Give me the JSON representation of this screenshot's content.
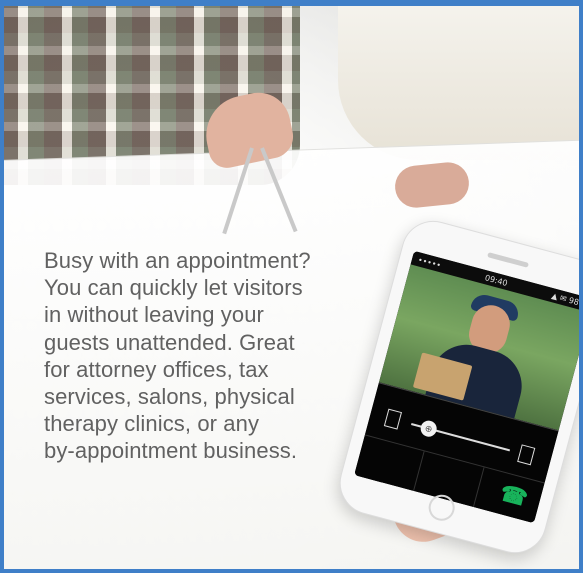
{
  "promo": {
    "lines": [
      "Busy with an appointment?",
      "You can quickly let visitors",
      "in without leaving your",
      "guests unattended. Great",
      "for attorney offices, tax",
      "services, salons, physical",
      "therapy clinics, or any",
      "by-appointment business."
    ]
  },
  "phone": {
    "status_left": "•••••",
    "status_center": "09:40",
    "status_right": "▲ ✉ 98%"
  },
  "colors": {
    "frame": "#3f7fc8",
    "text": "#616161",
    "call": "#18b35b"
  },
  "icons": {
    "door_left": "door-icon",
    "door_right": "door-icon",
    "call": "phone-call-icon",
    "slider": "unlock-slider-icon"
  }
}
